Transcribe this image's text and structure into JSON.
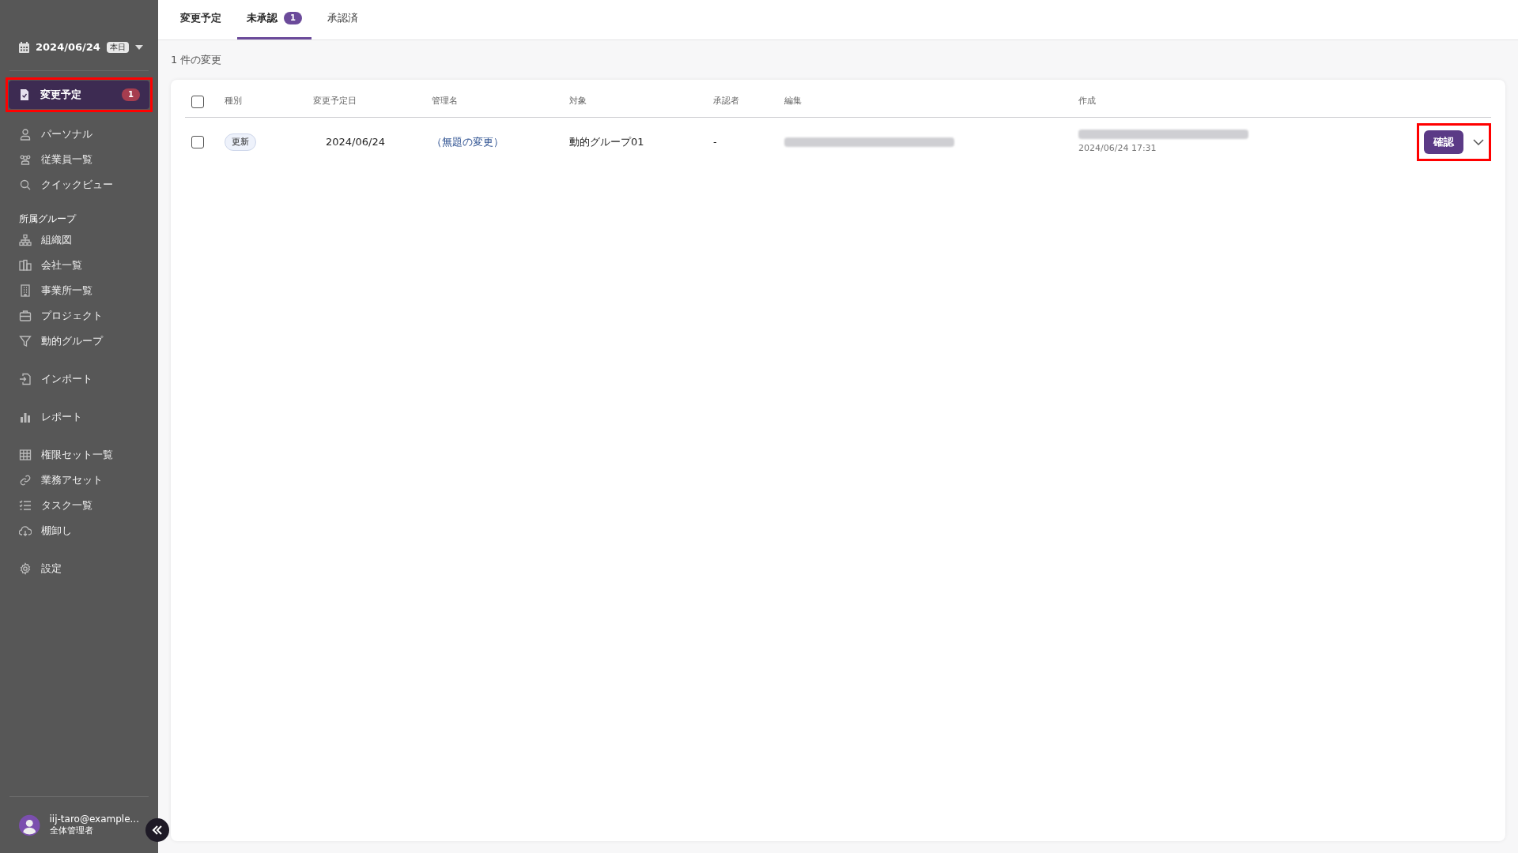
{
  "sidebar": {
    "date": "2024/06/24",
    "today_badge": "本日",
    "groups": [
      {
        "items": [
          {
            "label": "変更予定",
            "badge": "1",
            "selected": true,
            "highlighted": true
          }
        ]
      },
      {
        "items": [
          {
            "label": "パーソナル",
            "selected": false
          },
          {
            "label": "従業員一覧",
            "selected": false
          },
          {
            "label": "クイックビュー",
            "selected": false
          }
        ]
      },
      {
        "heading": "所属グループ",
        "items": [
          {
            "label": "組織図",
            "selected": false
          },
          {
            "label": "会社一覧",
            "selected": false
          },
          {
            "label": "事業所一覧",
            "selected": false
          },
          {
            "label": "プロジェクト",
            "selected": false
          },
          {
            "label": "動的グループ",
            "selected": false
          }
        ]
      },
      {
        "items": [
          {
            "label": "インポート",
            "selected": false
          }
        ]
      },
      {
        "items": [
          {
            "label": "レポート",
            "selected": false
          }
        ]
      },
      {
        "items": [
          {
            "label": "権限セット一覧",
            "selected": false
          },
          {
            "label": "業務アセット",
            "selected": false
          },
          {
            "label": "タスク一覧",
            "selected": false
          },
          {
            "label": "棚卸し",
            "selected": false
          }
        ]
      },
      {
        "items": [
          {
            "label": "設定",
            "selected": false
          }
        ]
      }
    ],
    "user": {
      "email": "iij-taro@example...",
      "role": "全体管理者"
    }
  },
  "tabs": [
    {
      "label": "変更予定",
      "selected": false,
      "bold": true
    },
    {
      "label": "未承認",
      "badge": "1",
      "selected": true
    },
    {
      "label": "承認済",
      "selected": false
    }
  ],
  "count_text": "1 件の変更",
  "table": {
    "all_checked": false,
    "columns": [
      "種別",
      "変更予定日",
      "管理名",
      "対象",
      "承認者",
      "編集",
      "作成"
    ],
    "rows": [
      {
        "checked": false,
        "type": "更新",
        "date": "2024/06/24",
        "name": "（無題の変更）",
        "target": "動的グループ01",
        "approver": "-",
        "editor": {
          "kind": "redacted"
        },
        "created": {
          "kind": "redacted",
          "time": "2024/06/24 17:31"
        },
        "action": "確認",
        "action_highlighted": true
      }
    ]
  }
}
